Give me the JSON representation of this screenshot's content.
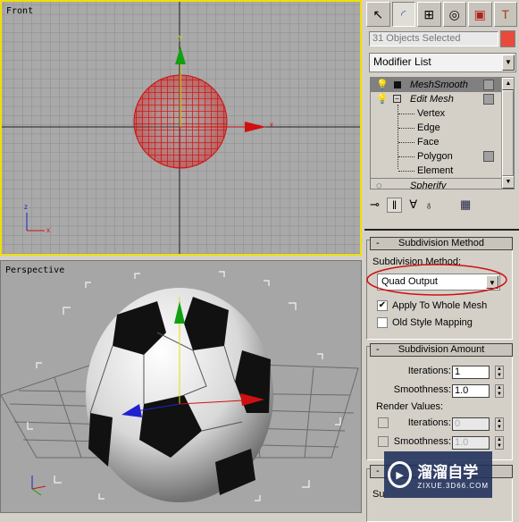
{
  "viewports": {
    "front": {
      "label": "Front"
    },
    "perspective": {
      "label": "Perspective"
    }
  },
  "axes": {
    "x": "x",
    "y": "y",
    "z": "z"
  },
  "colors": {
    "active_viewport_border": "#f0e000",
    "selection": "#d02020",
    "object_color": "#e84a3c",
    "highlight": "#d01010"
  },
  "command_panel": {
    "tabs": [
      "create",
      "modify",
      "hierarchy",
      "motion",
      "display",
      "utilities"
    ],
    "selection_name": "31 Objects Selected",
    "modifier_list": "Modifier List",
    "stack": [
      {
        "label": "MeshSmooth",
        "italic": true,
        "selected": true
      },
      {
        "label": "Edit Mesh",
        "italic": true
      },
      {
        "label": "Vertex"
      },
      {
        "label": "Edge"
      },
      {
        "label": "Face"
      },
      {
        "label": "Polygon"
      },
      {
        "label": "Element"
      },
      {
        "label": "Spherify",
        "italic": true
      }
    ],
    "stack_tools": [
      "pin-stack",
      "show-end-result",
      "make-unique",
      "remove-modifier",
      "configure-modifier-sets"
    ]
  },
  "subdivision_method": {
    "title": "Subdivision Method",
    "minus": "-",
    "label": "Subdivision Method:",
    "value": "Quad Output",
    "apply_whole": {
      "label": "Apply To Whole Mesh",
      "checked": true
    },
    "old_style": {
      "label": "Old Style Mapping",
      "checked": false
    }
  },
  "subdivision_amount": {
    "title": "Subdivision Amount",
    "minus": "-",
    "iterations_label": "Iterations:",
    "iterations": "1",
    "smoothness_label": "Smoothness:",
    "smoothness": "1.0",
    "render_values": "Render Values:",
    "r_iterations_label": "Iterations:",
    "r_iterations": "0",
    "r_smoothness_label": "Smoothness:",
    "r_smoothness": "1.0"
  },
  "bottom_rollout": {
    "minus": "-",
    "partial_label": "Su"
  },
  "watermark": {
    "name": "溜溜自学",
    "url": "ZIXUE.3D66.COM"
  }
}
